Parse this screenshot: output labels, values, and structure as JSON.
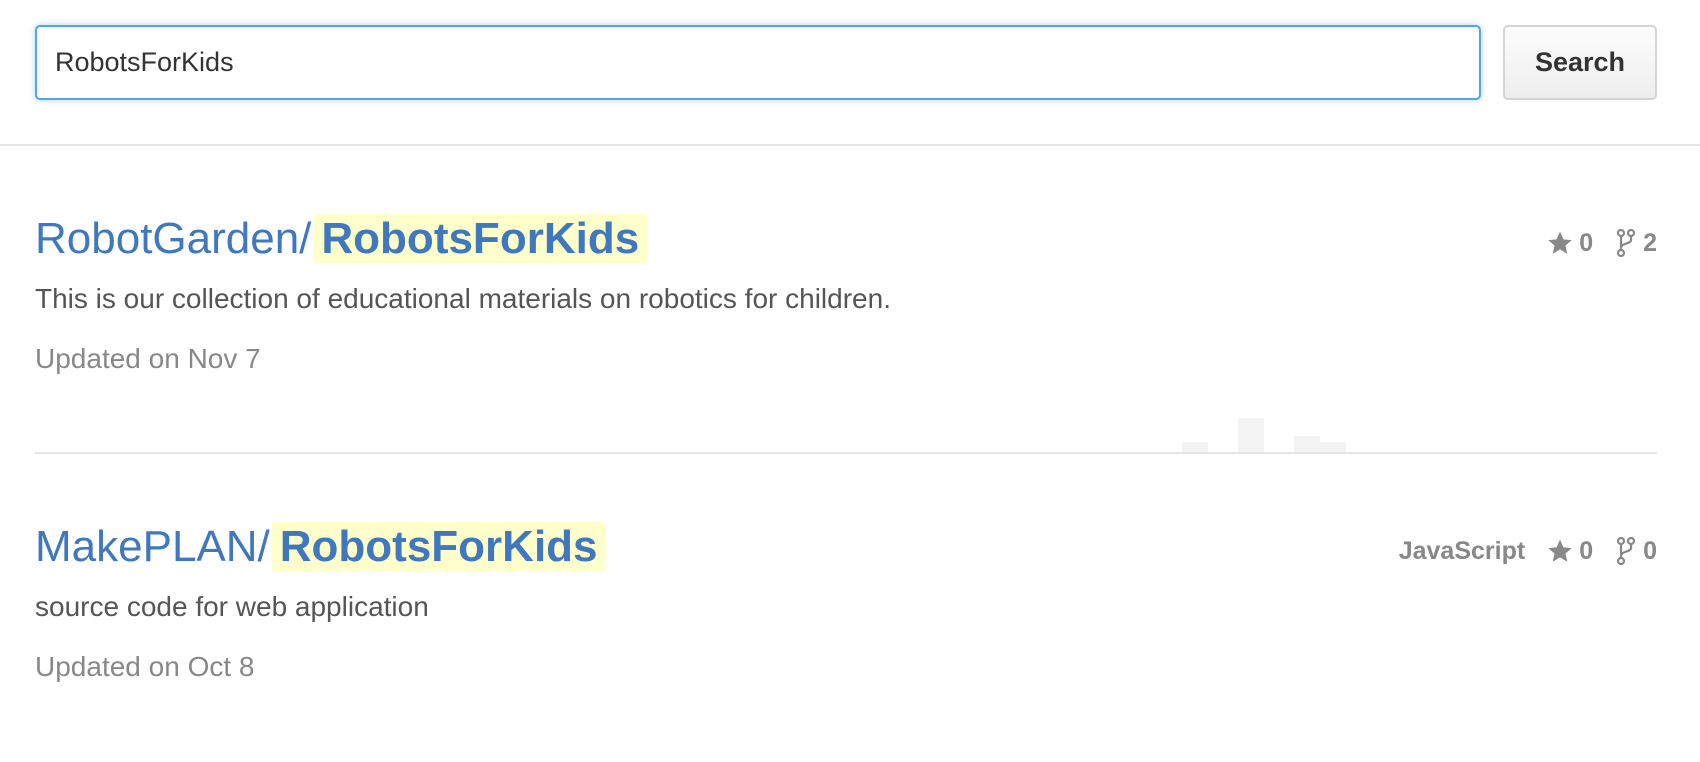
{
  "search": {
    "query": "RobotsForKids",
    "button_label": "Search"
  },
  "results": [
    {
      "owner": "RobotGarden/",
      "name": "RobotsForKids",
      "description": "This is our collection of educational materials on robotics for children.",
      "updated": "Updated on Nov 7",
      "language": "",
      "stars": "0",
      "forks": "2"
    },
    {
      "owner": "MakePLAN/",
      "name": "RobotsForKids",
      "description": "source code for web application",
      "updated": "Updated on Oct 8",
      "language": "JavaScript",
      "stars": "0",
      "forks": "0"
    }
  ],
  "colors": {
    "link": "#4078c0",
    "highlight": "#ffffcc",
    "focus_border": "#51a7e8",
    "muted": "#888888"
  }
}
